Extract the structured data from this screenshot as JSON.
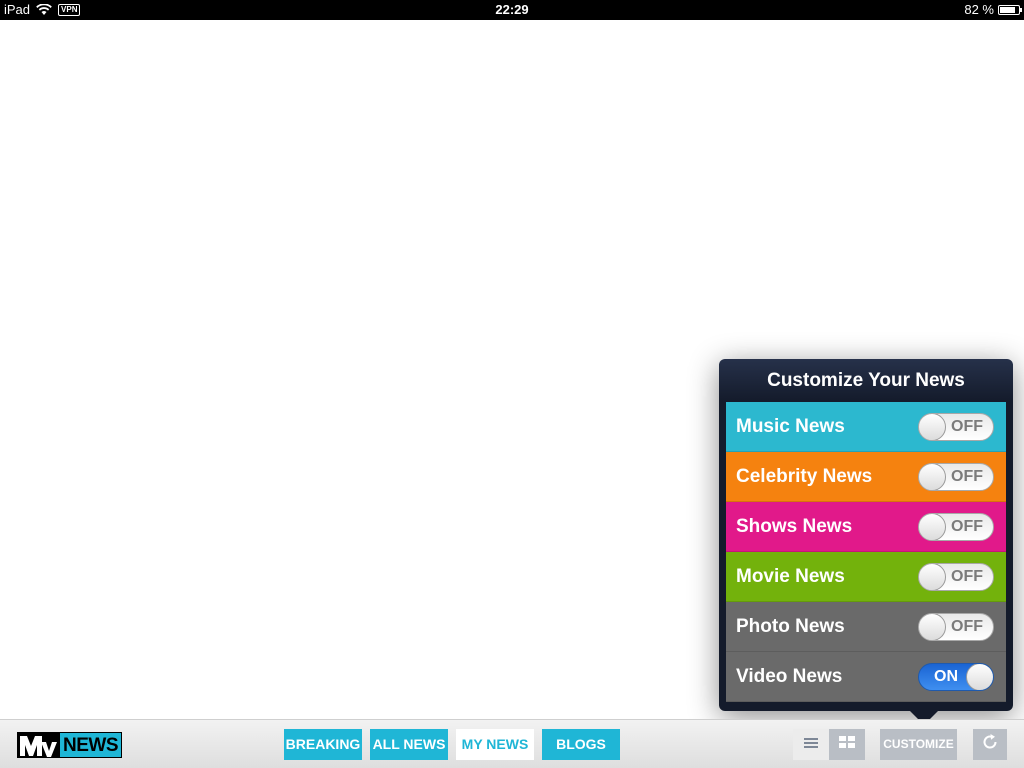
{
  "status_bar": {
    "carrier": "iPad",
    "vpn": "VPN",
    "time": "22:29",
    "battery_text": "82 %",
    "battery_level": 0.82
  },
  "toolbar": {
    "logo_text": "NEWS",
    "tabs": [
      {
        "label": "BREAKING",
        "active": false
      },
      {
        "label": "ALL NEWS",
        "active": false
      },
      {
        "label": "MY NEWS",
        "active": true
      },
      {
        "label": "BLOGS",
        "active": false
      }
    ],
    "customize_label": "CUSTOMIZE",
    "icons": {
      "list_view": "list-view-icon",
      "grid_view": "grid-view-icon",
      "refresh": "refresh-icon"
    }
  },
  "popover": {
    "title": "Customize Your News",
    "items": [
      {
        "label": "Music News",
        "state": "OFF",
        "color": "#2cb8cf"
      },
      {
        "label": "Celebrity News",
        "state": "OFF",
        "color": "#f5820f"
      },
      {
        "label": "Shows News",
        "state": "OFF",
        "color": "#e1198a"
      },
      {
        "label": "Movie News",
        "state": "OFF",
        "color": "#73b20c"
      },
      {
        "label": "Photo News",
        "state": "OFF",
        "color": "#6a6a6a"
      },
      {
        "label": "Video News",
        "state": "ON",
        "color": "#6a6a6a"
      }
    ]
  },
  "colors": {
    "accent": "#1fb6d6",
    "toggle_on": "#2f7fe6"
  }
}
